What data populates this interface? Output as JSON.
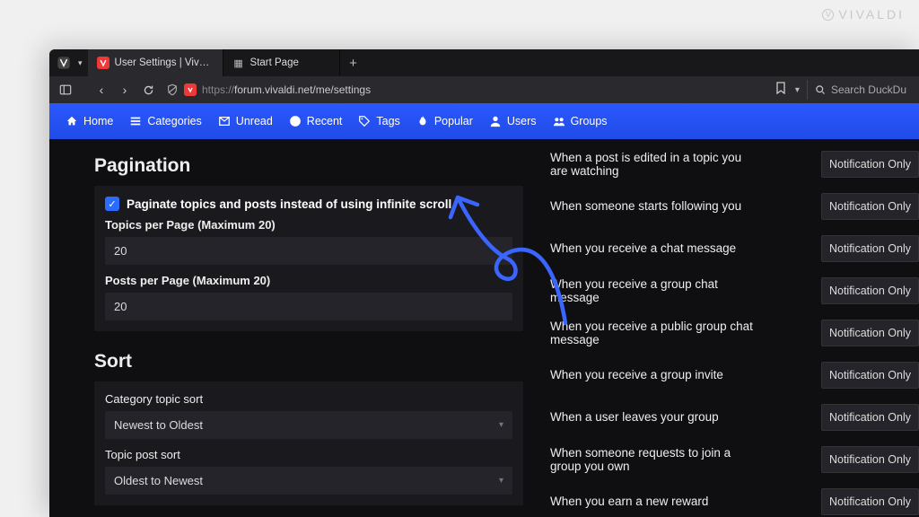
{
  "watermark": "VIVALDI",
  "tabs": {
    "active": "User Settings | Vivaldi Forum",
    "second": "Start Page"
  },
  "url": {
    "protocol": "https://",
    "rest": "forum.vivaldi.net/me/settings"
  },
  "search": {
    "placeholder": "Search DuckDu"
  },
  "nav": {
    "home": "Home",
    "categories": "Categories",
    "unread": "Unread",
    "recent": "Recent",
    "tags": "Tags",
    "popular": "Popular",
    "users": "Users",
    "groups": "Groups"
  },
  "pagination": {
    "title": "Pagination",
    "checkbox": "Paginate topics and posts instead of using infinite scroll",
    "topics_label": "Topics per Page (Maximum 20)",
    "topics_value": "20",
    "posts_label": "Posts per Page (Maximum 20)",
    "posts_value": "20"
  },
  "sort": {
    "title": "Sort",
    "cat_label": "Category topic sort",
    "cat_value": "Newest to Oldest",
    "topic_label": "Topic post sort",
    "topic_value": "Oldest to Newest"
  },
  "notif": {
    "btn": "Notification Only",
    "items": [
      "When a post is edited in a topic you are watching",
      "When someone starts following you",
      "When you receive a chat message",
      "When you receive a group chat message",
      "When you receive a public group chat message",
      "When you receive a group invite",
      "When a user leaves your group",
      "When someone requests to join a group you own",
      "When you earn a new reward"
    ]
  }
}
